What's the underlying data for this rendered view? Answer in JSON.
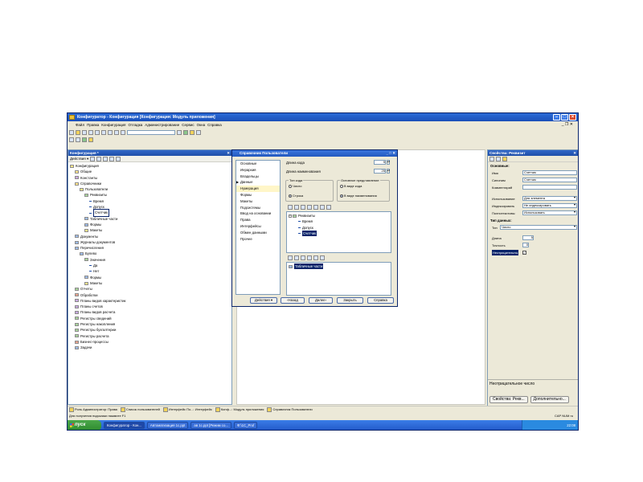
{
  "window": {
    "title": "Конфигуратор - Конфигурация [Конфигурация: Модуль приложения]"
  },
  "menu": [
    "Файл",
    "Правка",
    "Конфигурация",
    "Отладка",
    "Администрирование",
    "Сервис",
    "Окна",
    "Справка"
  ],
  "config_panel": {
    "title": "Конфигурация *",
    "actions_label": "Действия ▾",
    "tree": [
      {
        "label": "Конфигурация",
        "level": 0,
        "icon": "config"
      },
      {
        "label": "Общие",
        "level": 1,
        "icon": "folder"
      },
      {
        "label": "Константы",
        "level": 1,
        "icon": "const"
      },
      {
        "label": "Справочники",
        "level": 1,
        "icon": "catalog"
      },
      {
        "label": "Пользователи",
        "level": 2,
        "icon": "catalog"
      },
      {
        "label": "Реквизиты",
        "level": 3,
        "icon": "props"
      },
      {
        "label": "Время",
        "level": 4,
        "icon": "dash"
      },
      {
        "label": "Допуск",
        "level": 4,
        "icon": "dash"
      },
      {
        "label": "Счетчик",
        "level": 4,
        "icon": "dash",
        "selected": true
      },
      {
        "label": "Табличные части",
        "level": 3,
        "icon": "table"
      },
      {
        "label": "Формы",
        "level": 3,
        "icon": "forms"
      },
      {
        "label": "Макеты",
        "level": 3,
        "icon": "layout"
      },
      {
        "label": "Документы",
        "level": 1,
        "icon": "doc"
      },
      {
        "label": "Журналы документов",
        "level": 1,
        "icon": "journal"
      },
      {
        "label": "Перечисления",
        "level": 1,
        "icon": "enum"
      },
      {
        "label": "Булево",
        "level": 2,
        "icon": "enum"
      },
      {
        "label": "Значения",
        "level": 3,
        "icon": "props"
      },
      {
        "label": "Да",
        "level": 4,
        "icon": "dash"
      },
      {
        "label": "Нет",
        "level": 4,
        "icon": "dash"
      },
      {
        "label": "Формы",
        "level": 3,
        "icon": "forms"
      },
      {
        "label": "Макеты",
        "level": 3,
        "icon": "layout"
      },
      {
        "label": "Отчеты",
        "level": 1,
        "icon": "report"
      },
      {
        "label": "Обработки",
        "level": 1,
        "icon": "processing"
      },
      {
        "label": "Планы видов характеристик",
        "level": 1,
        "icon": "plan"
      },
      {
        "label": "Планы счетов",
        "level": 1,
        "icon": "plan"
      },
      {
        "label": "Планы видов расчета",
        "level": 1,
        "icon": "plan"
      },
      {
        "label": "Регистры сведений",
        "level": 1,
        "icon": "register"
      },
      {
        "label": "Регистры накопления",
        "level": 1,
        "icon": "register"
      },
      {
        "label": "Регистры бухгалтерии",
        "level": 1,
        "icon": "register"
      },
      {
        "label": "Регистры расчета",
        "level": 1,
        "icon": "register"
      },
      {
        "label": "Бизнес-процессы",
        "level": 1,
        "icon": "process"
      },
      {
        "label": "Задачи",
        "level": 1,
        "icon": "task"
      }
    ]
  },
  "dialog": {
    "title": "Справочник Пользователи",
    "nav": [
      "Основные",
      "Иерархия",
      "Владельцы",
      "Данные",
      "Нумерация",
      "Формы",
      "Макеты",
      "Подсистемы",
      "Ввод на основании",
      "Права",
      "Интерфейсы",
      "Обмен данными",
      "Прочее"
    ],
    "active_nav": "Данные",
    "code_length_label": "Длина кода",
    "code_length_value": "9",
    "name_length_label": "Длина наименования",
    "name_length_value": "25",
    "code_type_group": "Тип кода",
    "code_type_number": "Число",
    "code_type_string": "Строка",
    "main_repr_group": "Основное представление",
    "repr_code": "В виде кода",
    "repr_name": "В виде наименования",
    "attributes_tree": [
      "Реквизиты",
      "Время",
      "Допуск",
      "Счетчик"
    ],
    "tabular_sections": [
      "Табличные части"
    ],
    "buttons": {
      "actions": "Действия ▾",
      "back": "‹Назад",
      "next": "Далее›",
      "close": "Закрыть",
      "help": "Справка"
    }
  },
  "props": {
    "title": "Свойства: Реквизит",
    "section_main": "Основные:",
    "name_label": "Имя",
    "name_value": "Счетчик",
    "synonym_label": "Синоним",
    "synonym_value": "Счетчик",
    "comment_label": "Комментарий",
    "comment_value": "",
    "usage_label": "Использование",
    "usage_value": "Для элемента",
    "index_label": "Индексировать",
    "index_value": "Не индексировать",
    "fulltext_label": "Полнотекстовы",
    "fulltext_value": "Использовать",
    "section_type": "Тип данных:",
    "type_label": "Тип",
    "type_value": "Число",
    "length_label": "Длина",
    "length_value": "5",
    "precision_label": "Точность",
    "precision_value": "0",
    "nonneg_label": "Неотрицательны",
    "nonneg_checked": true,
    "hint": "Неотрицательное число",
    "bottom_tab1": "Свойства: Рекв...",
    "bottom_tab2": "Дополнительно..."
  },
  "window_tabs": [
    "Роль Администратор: Права",
    "Список пользователей",
    "Интерфейс По...: Интерфейс",
    "Конф...: Модуль приложения",
    "Справочник Пользователи"
  ],
  "status": {
    "left": "Для получения подсказки нажмите F1",
    "right": "CAP  NUM  ru"
  },
  "taskbar": {
    "start": "пуск",
    "tasks": [
      "Конфигуратор - Кон...",
      "Автоматизация 1с.ppt",
      "ав 1с.ppt [Режим со...",
      "Ф:\\1С_Prof"
    ],
    "clock": "22:08"
  },
  "colors": {
    "title_blue": "#1a4fb8",
    "selection": "#0a246a",
    "face": "#ece9d8",
    "start_green": "#3ab53a"
  }
}
